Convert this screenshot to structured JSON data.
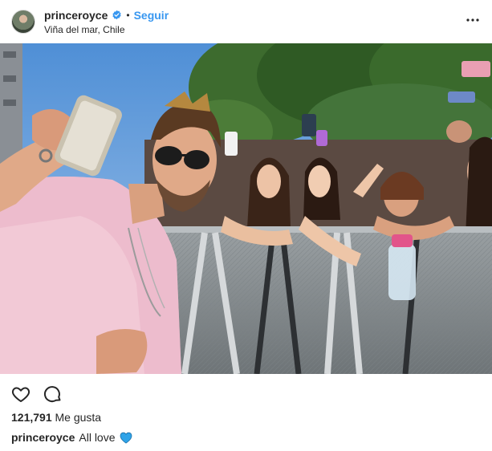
{
  "header": {
    "username": "princeroyce",
    "separator": "•",
    "follow_label": "Seguir",
    "location": "Viña del mar, Chile"
  },
  "icons": {
    "avatar": "profile-avatar",
    "verified": "verified-badge-icon",
    "more": "more-options-icon",
    "like": "heart-outline-icon",
    "comment": "comment-bubble-icon",
    "caption_emoji": "blue-heart-emoji"
  },
  "photo": {
    "description_name": "selfie-with-fans-photo"
  },
  "engagement": {
    "likes_count": "121,791",
    "likes_label": "Me gusta"
  },
  "caption": {
    "username": "princeroyce",
    "text": "All love"
  },
  "colors": {
    "link_blue": "#3897f0",
    "text": "#262626",
    "verified_blue": "#3897f0",
    "heart_emoji": "#2fa3e8"
  }
}
